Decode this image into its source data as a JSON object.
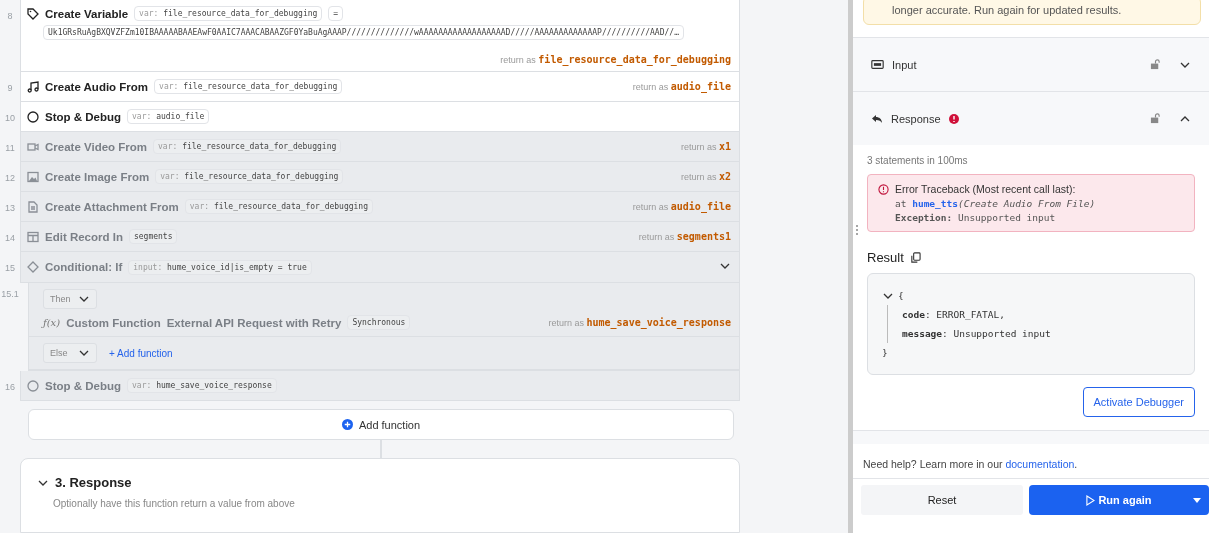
{
  "steps": [
    {
      "number": "8",
      "kind": "variable",
      "title": "Create Variable",
      "disabled": false,
      "tags": [
        {
          "prefix": "var:",
          "value": "file_resource_data_for_debugging"
        },
        {
          "value": "="
        }
      ],
      "value": "Uk1GRsRuAgBXQVZFZm10IBAAAAABAAEAwF0AAIC7AAACABAAZGF0YaBuAgAAAP//////////////wAAAAAAAAAAAAAAAAAAD/////AAAAAAAAAAAAAP//////////AAD//…",
      "return_label": "return as",
      "return_value": "file_resource_data_for_debugging"
    },
    {
      "number": "9",
      "kind": "step",
      "title": "Create Audio From",
      "disabled": false,
      "tags": [
        {
          "prefix": "var:",
          "value": "file_resource_data_for_debugging"
        }
      ],
      "return_label": "return as",
      "return_value": "audio_file"
    },
    {
      "number": "10",
      "kind": "step",
      "title": "Stop & Debug",
      "disabled": false,
      "tags": [
        {
          "prefix": "var:",
          "value": "audio_file"
        }
      ]
    },
    {
      "number": "11",
      "kind": "step",
      "title": "Create Video From",
      "disabled": true,
      "tags": [
        {
          "prefix": "var:",
          "value": "file_resource_data_for_debugging"
        }
      ],
      "return_label": "return as",
      "return_value": "x1"
    },
    {
      "number": "12",
      "kind": "step",
      "title": "Create Image From",
      "disabled": true,
      "tags": [
        {
          "prefix": "var:",
          "value": "file_resource_data_for_debugging"
        }
      ],
      "return_label": "return as",
      "return_value": "x2"
    },
    {
      "number": "13",
      "kind": "step",
      "title": "Create Attachment From",
      "disabled": true,
      "tags": [
        {
          "prefix": "var:",
          "value": "file_resource_data_for_debugging"
        }
      ],
      "return_label": "return as",
      "return_value": "audio_file"
    },
    {
      "number": "14",
      "kind": "step",
      "title": "Edit Record In",
      "disabled": true,
      "tags": [
        {
          "value": "segments"
        }
      ],
      "return_label": "return as",
      "return_value": "segments1"
    },
    {
      "number": "15",
      "kind": "conditional",
      "title": "Conditional: If",
      "disabled": true,
      "tags": [
        {
          "prefix": "input:",
          "value": "hume_voice_id|is_empty = true"
        }
      ],
      "branches": [
        {
          "number": "15.1",
          "label": "Then",
          "function": {
            "symbol": "ƒ(x)",
            "title": "Custom Function",
            "name": "External API Request with Retry",
            "tag": "Synchronous",
            "return_label": "return as",
            "return_value": "hume_save_voice_response"
          }
        },
        {
          "label": "Else",
          "add_label": "+ Add function"
        }
      ]
    },
    {
      "number": "16",
      "kind": "step",
      "title": "Stop & Debug",
      "disabled": true,
      "tags": [
        {
          "prefix": "var:",
          "value": "hume_save_voice_response"
        }
      ]
    }
  ],
  "add_function": "Add function",
  "response_section": {
    "title": "3. Response",
    "subtitle": "Optionally have this function return a value from above"
  },
  "panel": {
    "banner": "longer accurate. Run again for updated results.",
    "sections": [
      {
        "title": "Input",
        "expanded": false,
        "error": false
      },
      {
        "title": "Response",
        "expanded": true,
        "error": true
      }
    ],
    "stats": "3 statements in 100ms",
    "error": {
      "title": "Error Traceback (Most recent call last):",
      "at": "at",
      "fn": "hume_tts",
      "where": "(Create Audio From File)",
      "exception_label": "Exception:",
      "exception": "Unsupported input"
    },
    "result_title": "Result",
    "result_open": "{",
    "result_close": "}",
    "result": [
      "**code**: ERROR_FATAL,",
      "**message**: Unsupported input"
    ],
    "debugger": "Activate Debugger",
    "help": "Need help? Learn more in our",
    "help_link": "documentation",
    "help_end": ".",
    "reset": "Reset",
    "run": "Run again"
  }
}
